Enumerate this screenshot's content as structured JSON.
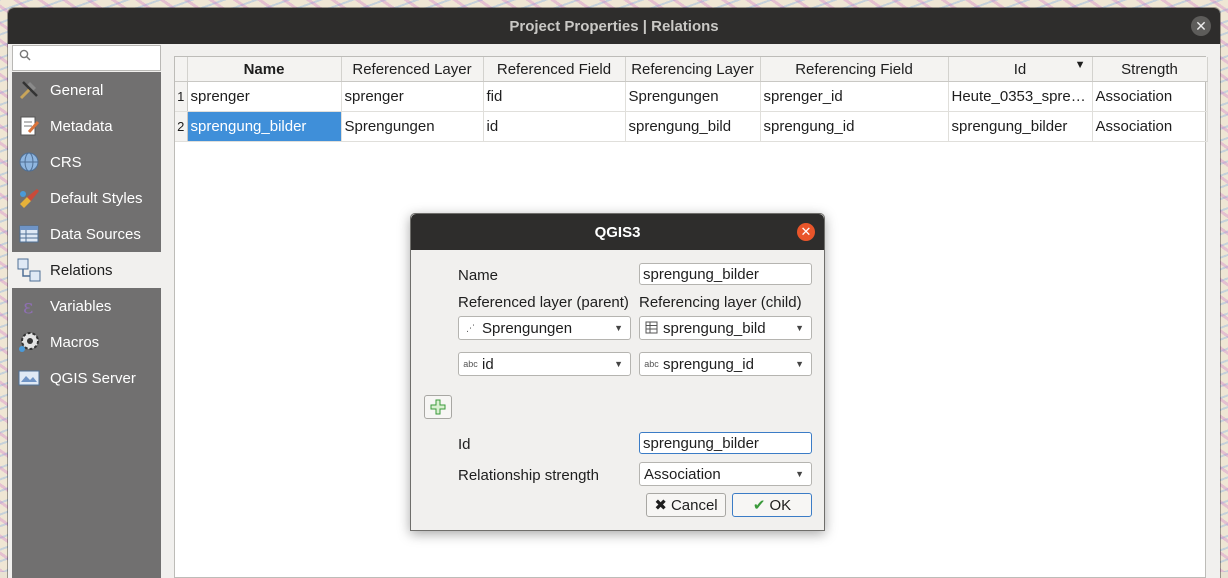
{
  "window": {
    "title": "Project Properties | Relations",
    "close_glyph": "✕"
  },
  "sidebar": {
    "search_placeholder": "",
    "items": [
      {
        "label": "General",
        "icon": "tools-icon"
      },
      {
        "label": "Metadata",
        "icon": "metadata-icon"
      },
      {
        "label": "CRS",
        "icon": "globe-icon"
      },
      {
        "label": "Default Styles",
        "icon": "styles-icon"
      },
      {
        "label": "Data Sources",
        "icon": "table-icon"
      },
      {
        "label": "Relations",
        "icon": "relations-icon"
      },
      {
        "label": "Variables",
        "icon": "variables-icon"
      },
      {
        "label": "Macros",
        "icon": "macros-icon"
      },
      {
        "label": "QGIS Server",
        "icon": "server-icon"
      }
    ],
    "active_index": 5
  },
  "table": {
    "columns": [
      "Name",
      "Referenced Layer",
      "Referenced Field",
      "Referencing Layer",
      "Referencing Field",
      "Id",
      "Strength"
    ],
    "rows": [
      {
        "num": "1",
        "cells": [
          "sprenger",
          "sprenger",
          "fid",
          "Sprengungen",
          "sprenger_id",
          "Heute_0353_spre…",
          "Association"
        ]
      },
      {
        "num": "2",
        "cells": [
          "sprengung_bilder",
          "Sprengungen",
          "id",
          "sprengung_bild",
          "sprengung_id",
          "sprengung_bilder",
          "Association"
        ]
      }
    ]
  },
  "dialog": {
    "title": "QGIS3",
    "name_label": "Name",
    "name_value": "sprengung_bilder",
    "referenced_layer_label": "Referenced layer (parent)",
    "referencing_layer_label": "Referencing layer (child)",
    "referenced_layer_value": "Sprengungen",
    "referencing_layer_value": "sprengung_bild",
    "referenced_field_value": "id",
    "referencing_field_value": "sprengung_id",
    "field_type_badge": "abc",
    "id_label": "Id",
    "id_value": "sprengung_bilder",
    "strength_label": "Relationship strength",
    "strength_value": "Association",
    "cancel_label": "Cancel",
    "ok_label": "OK"
  },
  "colors": {
    "selection": "#3f8fd9",
    "titlebar": "#2e2d2c",
    "sidebar": "#717070",
    "dialog_close": "#e9552a"
  }
}
